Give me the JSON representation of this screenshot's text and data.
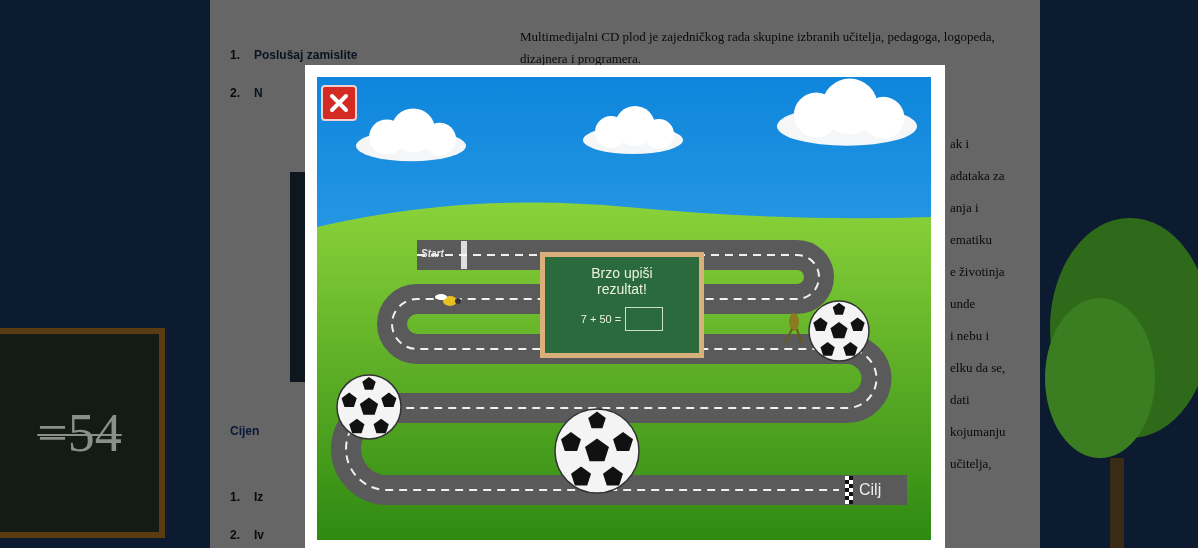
{
  "background_page": {
    "paragraph": "Multimedijalni CD plod je zajedničkog rada skupine izbranih učitelja, pedagoga, logopeda, dizajnera i programera.",
    "top_list": [
      {
        "number": "1.",
        "text": "Poslušaj zamislite"
      },
      {
        "number": "2.",
        "text": "N"
      }
    ],
    "section_heading": "Cijen",
    "section_list": [
      {
        "number": "1.",
        "text": "Iz"
      },
      {
        "number": "2.",
        "text": "Iv"
      }
    ],
    "right_fragments": [
      "ak i",
      "adataka za",
      "anja i",
      "ematiku",
      "e životinja",
      "unde",
      "i nebu i",
      "elku da se,",
      "dati",
      "kojumanju",
      "učitelja,"
    ],
    "board_text": "=54"
  },
  "dialog": {
    "game": {
      "start_label": "Start",
      "finish_label": "Cilj",
      "prompt": "Brzo upiši rezultat!",
      "equation": "7 + 50 ="
    }
  }
}
